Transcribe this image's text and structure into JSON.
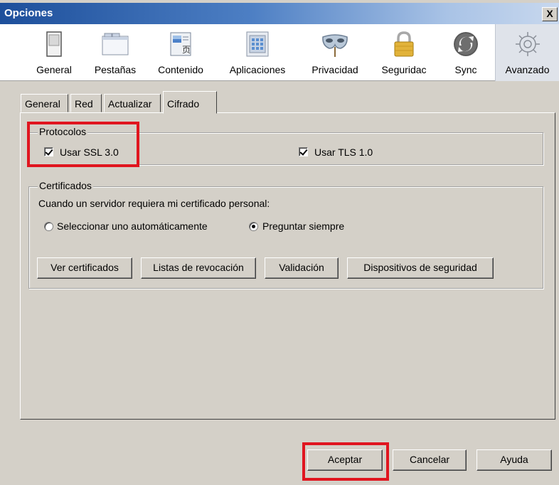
{
  "window": {
    "title": "Opciones",
    "close_label": "X"
  },
  "toolbar": {
    "items": [
      {
        "label": "General",
        "icon": "switch-icon"
      },
      {
        "label": "Pestañas",
        "icon": "tabs-window-icon"
      },
      {
        "label": "Contenido",
        "icon": "content-icon"
      },
      {
        "label": "Aplicaciones",
        "icon": "applications-icon"
      },
      {
        "label": "Privacidad",
        "icon": "mask-icon"
      },
      {
        "label": "Seguridac",
        "icon": "padlock-icon"
      },
      {
        "label": "Sync",
        "icon": "sync-icon"
      },
      {
        "label": "Avanzado",
        "icon": "gear-icon"
      }
    ],
    "selected": "Avanzado"
  },
  "tabs": [
    "General",
    "Red",
    "Actualizar",
    "Cifrado"
  ],
  "active_tab": "Cifrado",
  "protocols": {
    "legend": "Protocolos",
    "ssl_label": "Usar SSL 3.0",
    "ssl_checked": true,
    "tls_label": "Usar TLS 1.0",
    "tls_checked": true
  },
  "certificates": {
    "legend": "Certificados",
    "prompt": "Cuando un servidor requiera mi certificado personal:",
    "radio_auto": "Seleccionar uno automáticamente",
    "radio_ask": "Preguntar siempre",
    "selected": "Preguntar siempre",
    "buttons": {
      "view": "Ver certificados",
      "revocation": "Listas de revocación",
      "validation": "Validación",
      "devices": "Dispositivos de seguridad"
    }
  },
  "footer": {
    "ok": "Aceptar",
    "cancel": "Cancelar",
    "help": "Ayuda"
  },
  "colors": {
    "highlight": "#e0151f",
    "titlebar": "#1d4f9b",
    "dialog_bg": "#d4d0c8"
  }
}
